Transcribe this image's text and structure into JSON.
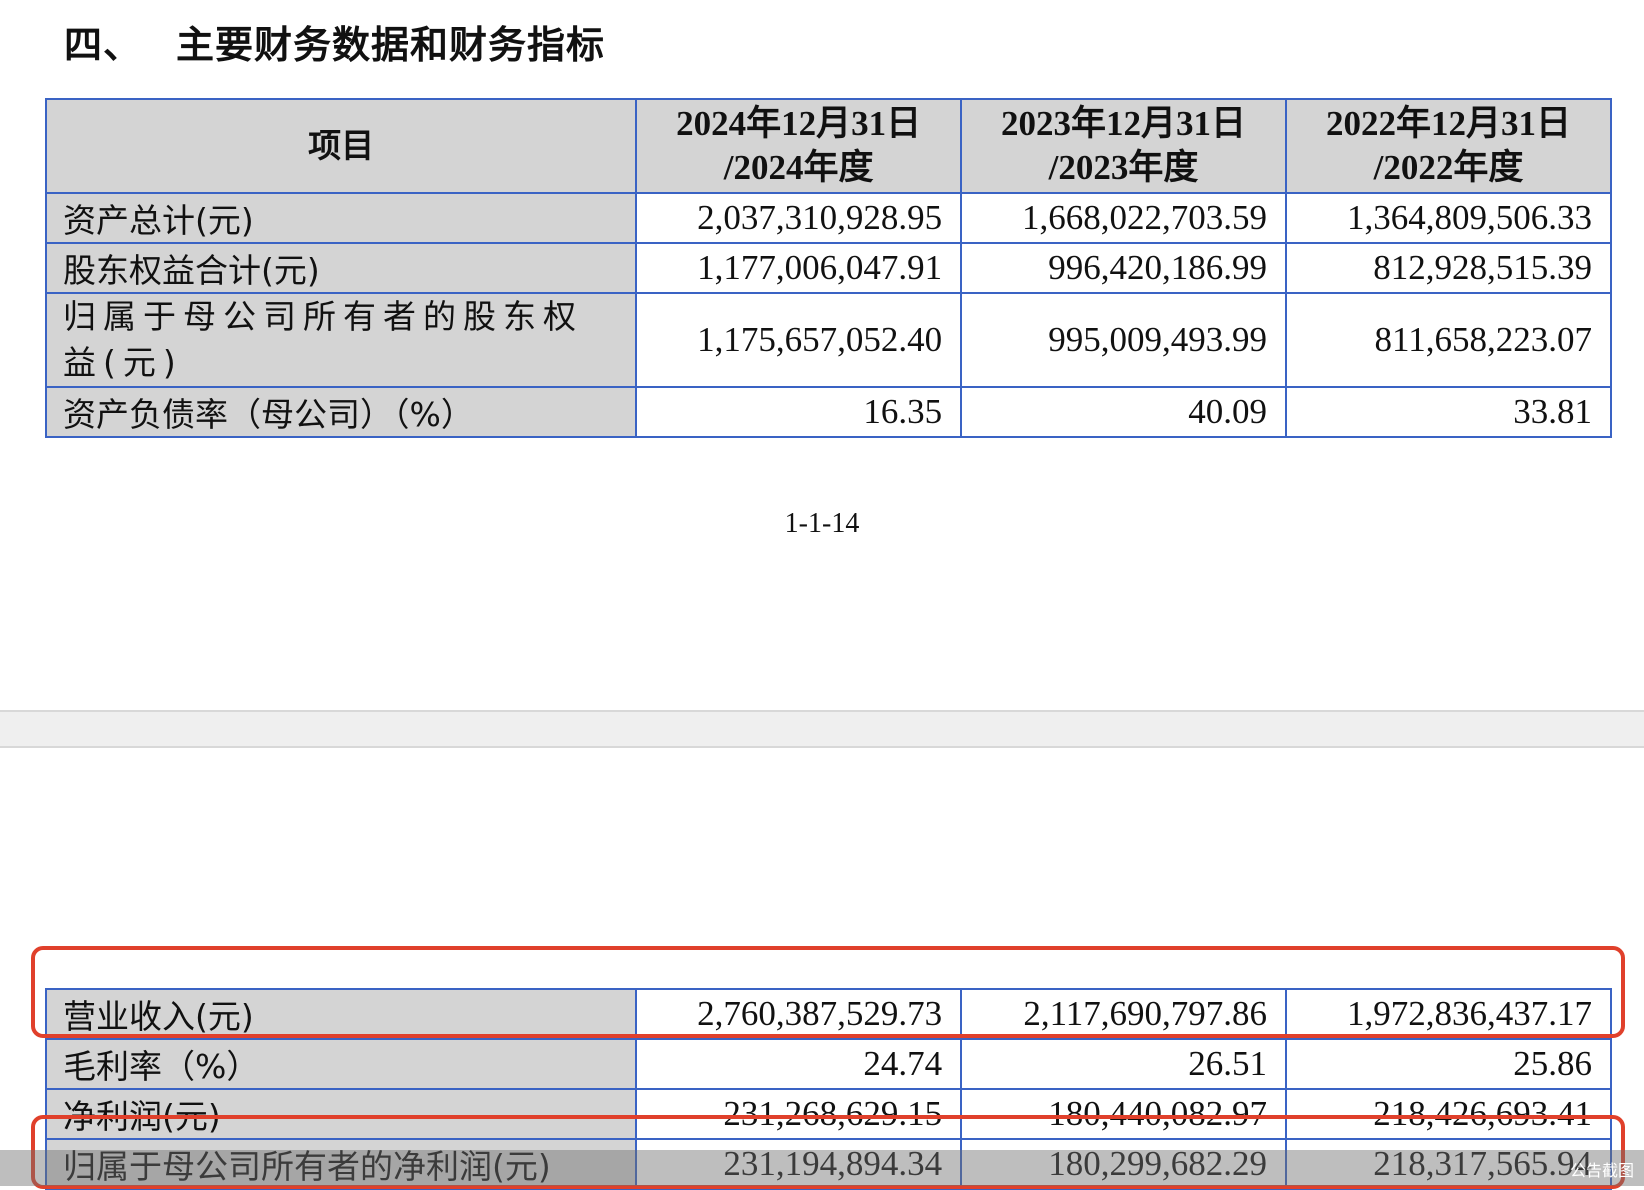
{
  "section": {
    "number": "四、",
    "title": "主要财务数据和财务指标"
  },
  "table_header": {
    "item": "项目",
    "col1_line1": "2024年12月31日",
    "col1_line2": "/2024年度",
    "col2_line1": "2023年12月31日",
    "col2_line2": "/2023年度",
    "col3_line1": "2022年12月31日",
    "col3_line2": "/2022年度"
  },
  "top_rows": [
    {
      "label": "资产总计(元)",
      "v1": "2,037,310,928.95",
      "v2": "1,668,022,703.59",
      "v3": "1,364,809,506.33"
    },
    {
      "label": "股东权益合计(元)",
      "v1": "1,177,006,047.91",
      "v2": "996,420,186.99",
      "v3": "812,928,515.39"
    },
    {
      "label": "归属于母公司所有者的股东权益(元)",
      "v1": "1,175,657,052.40",
      "v2": "995,009,493.99",
      "v3": "811,658,223.07"
    },
    {
      "label": "资产负债率（母公司）（%）",
      "v1": "16.35",
      "v2": "40.09",
      "v3": "33.81"
    }
  ],
  "page_number": "1-1-14",
  "bottom_rows": [
    {
      "label": "营业收入(元)",
      "v1": "2,760,387,529.73",
      "v2": "2,117,690,797.86",
      "v3": "1,972,836,437.17"
    },
    {
      "label": "毛利率（%）",
      "v1": "24.74",
      "v2": "26.51",
      "v3": "25.86"
    },
    {
      "label": "净利润(元)",
      "v1": "231,268,629.15",
      "v2": "180,440,082.97",
      "v3": "218,426,693.41"
    },
    {
      "label": "归属于母公司所有者的净利润(元)",
      "v1": "231,194,894.34",
      "v2": "180,299,682.29",
      "v3": "218,317,565.94"
    }
  ],
  "watermark": "公告截图",
  "colors": {
    "table_border": "#3a63c4",
    "header_bg": "#d4d4d4",
    "highlight": "#e0402b"
  }
}
